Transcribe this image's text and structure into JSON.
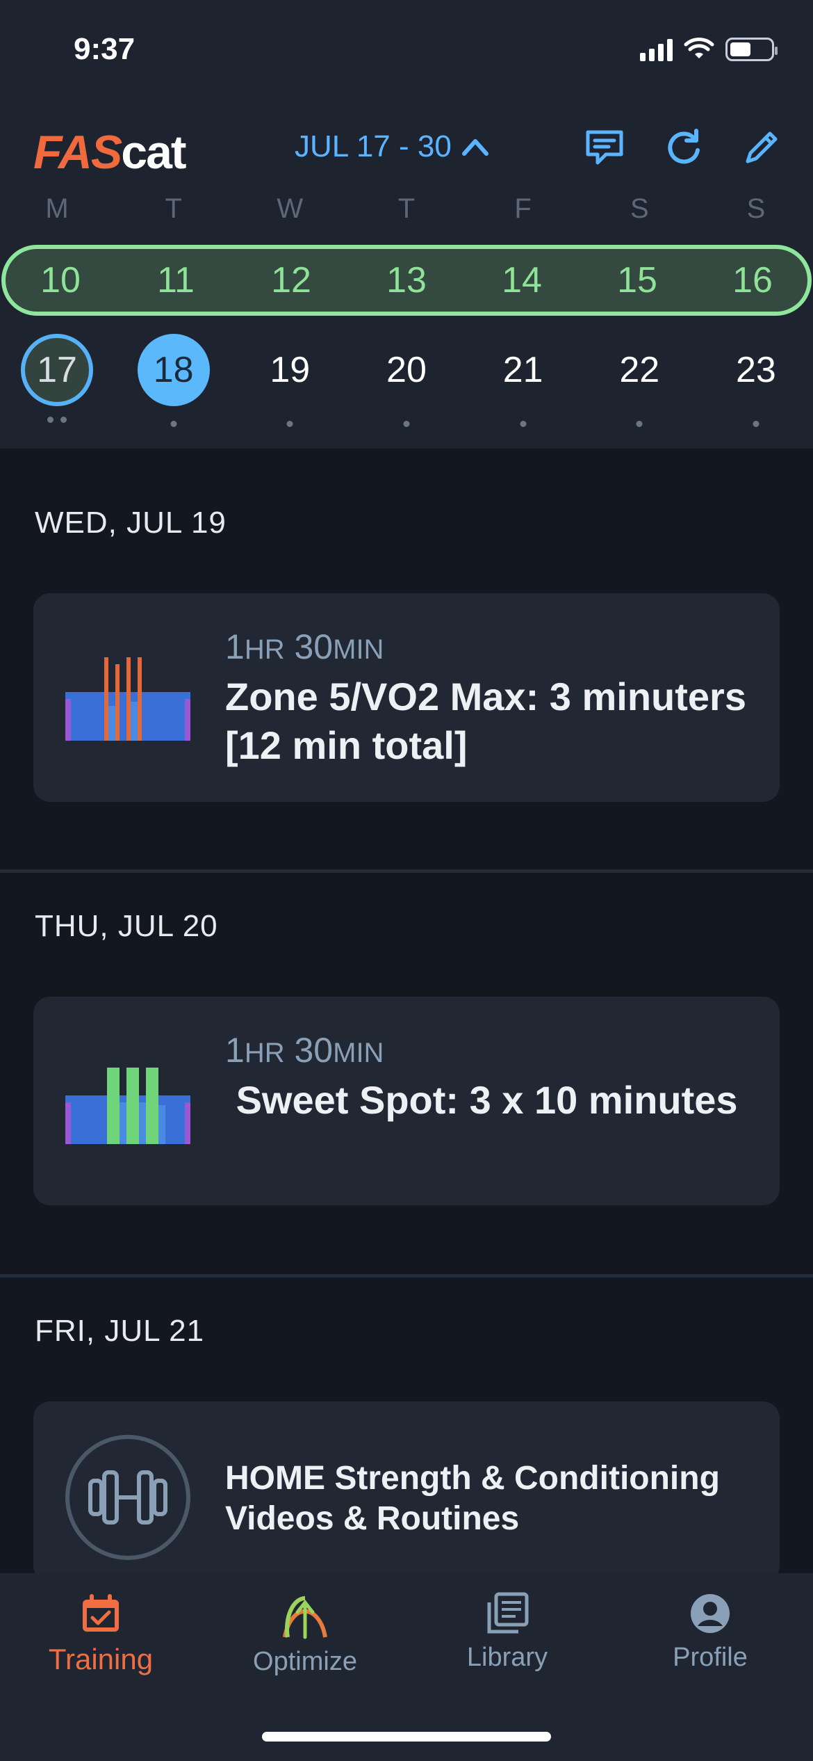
{
  "status": {
    "time": "9:37"
  },
  "header": {
    "logo_a": "FAS",
    "logo_b": "cat",
    "range": "JUL 17 - 30",
    "icons": [
      "chat-icon",
      "refresh-icon",
      "edit-icon"
    ]
  },
  "calendar": {
    "weekdays": [
      "M",
      "T",
      "W",
      "T",
      "F",
      "S",
      "S"
    ],
    "current_week": [
      "10",
      "11",
      "12",
      "13",
      "14",
      "15",
      "16"
    ],
    "next_week": [
      "17",
      "18",
      "19",
      "20",
      "21",
      "22",
      "23"
    ]
  },
  "days": [
    {
      "date": "WED, JUL 19",
      "duration_h": "1",
      "duration_h_unit": "HR",
      "duration_m": "30",
      "duration_m_unit": "MIN",
      "title": "Zone 5/VO2 Max: 3 minuters [12 min total]",
      "icon": "vo2-workout-graph-icon"
    },
    {
      "date": "THU, JUL 20",
      "duration_h": "1",
      "duration_h_unit": "HR",
      "duration_m": "30",
      "duration_m_unit": "MIN",
      "title": " Sweet Spot: 3 x 10 minutes",
      "icon": "sweet-spot-workout-graph-icon"
    },
    {
      "date": "FRI, JUL 21",
      "title": "HOME Strength & Conditioning Videos & Routines",
      "icon": "dumbbell-icon"
    }
  ],
  "nav": [
    {
      "label": "Training",
      "icon": "calendar-check-icon",
      "active": true
    },
    {
      "label": "Optimize",
      "icon": "arrow-arc-icon",
      "active": false
    },
    {
      "label": "Library",
      "icon": "library-icon",
      "active": false
    },
    {
      "label": "Profile",
      "icon": "profile-icon",
      "active": false
    }
  ],
  "colors": {
    "accent": "#5bb4ff",
    "brand": "#f06a3d",
    "week_highlight": "#8ee59c"
  }
}
